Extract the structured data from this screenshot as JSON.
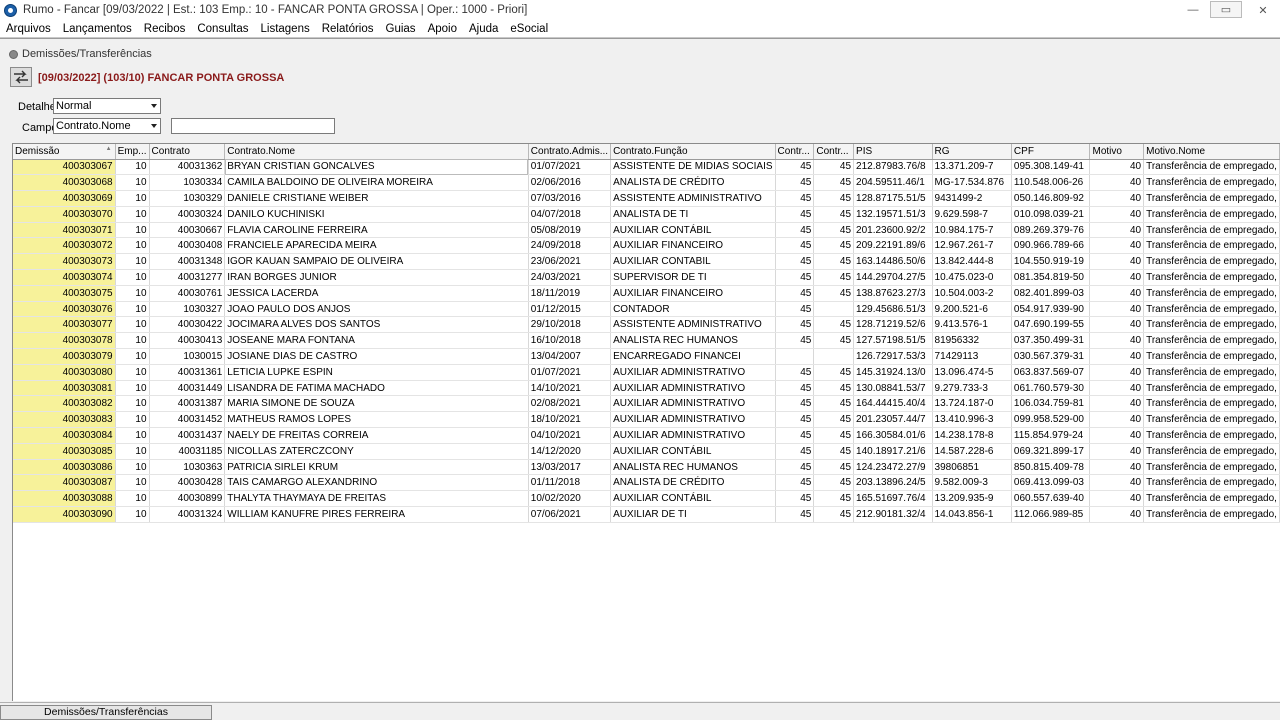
{
  "window": {
    "title": "Rumo - Fancar [09/03/2022 | Est.: 103 Emp.: 10 - FANCAR PONTA GROSSA | Oper.: 1000 - Priori]",
    "minimize": "—",
    "restore": "▭",
    "close": "✕"
  },
  "menu": [
    "Arquivos",
    "Lançamentos",
    "Recibos",
    "Consultas",
    "Listagens",
    "Relatórios",
    "Guias",
    "Apoio",
    "Ajuda",
    "eSocial"
  ],
  "document": {
    "title": "Demissões/Transferências",
    "info": "[09/03/2022] (103/10) FANCAR PONTA GROSSA"
  },
  "filters": {
    "detalhe_label": "Detalhe",
    "detalhe_value": "Normal",
    "campo_label": "Campo",
    "campo_value": "Contrato.Nome",
    "search_value": ""
  },
  "grid": {
    "columns": [
      "Demissão",
      "Emp...",
      "Contrato",
      "Contrato.Nome",
      "Contrato.Admis...",
      "Contrato.Função",
      "Contr...",
      "Contr...",
      "PIS",
      "RG",
      "CPF",
      "Motivo",
      "Motivo.Nome"
    ],
    "rows": [
      [
        "400303067",
        "10",
        "40031362",
        "BRYAN CRISTIAN GONCALVES",
        "01/07/2021",
        "ASSISTENTE DE MIDIAS SOCIAIS",
        "45",
        "45",
        "212.87983.76/8",
        "13.371.209-7",
        "095.308.149-41",
        "40",
        "Transferência de empregado,"
      ],
      [
        "400303068",
        "10",
        "1030334",
        "CAMILA BALDOINO DE OLIVEIRA MOREIRA",
        "02/06/2016",
        "ANALISTA DE CRÉDITO",
        "45",
        "45",
        "204.59511.46/1",
        "MG-17.534.876",
        "110.548.006-26",
        "40",
        "Transferência de empregado,"
      ],
      [
        "400303069",
        "10",
        "1030329",
        "DANIELE CRISTIANE WEIBER",
        "07/03/2016",
        "ASSISTENTE ADMINISTRATIVO",
        "45",
        "45",
        "128.87175.51/5",
        "9431499-2",
        "050.146.809-92",
        "40",
        "Transferência de empregado,"
      ],
      [
        "400303070",
        "10",
        "40030324",
        "DANILO KUCHINISKI",
        "04/07/2018",
        "ANALISTA DE TI",
        "45",
        "45",
        "132.19571.51/3",
        "9.629.598-7",
        "010.098.039-21",
        "40",
        "Transferência de empregado,"
      ],
      [
        "400303071",
        "10",
        "40030667",
        "FLAVIA CAROLINE FERREIRA",
        "05/08/2019",
        "AUXILIAR CONTÁBIL",
        "45",
        "45",
        "201.23600.92/2",
        "10.984.175-7",
        "089.269.379-76",
        "40",
        "Transferência de empregado,"
      ],
      [
        "400303072",
        "10",
        "40030408",
        "FRANCIELE APARECIDA MEIRA",
        "24/09/2018",
        "AUXILIAR FINANCEIRO",
        "45",
        "45",
        "209.22191.89/6",
        "12.967.261-7",
        "090.966.789-66",
        "40",
        "Transferência de empregado,"
      ],
      [
        "400303073",
        "10",
        "40031348",
        "IGOR KAUAN SAMPAIO DE OLIVEIRA",
        "23/06/2021",
        "AUXILIAR CONTABIL",
        "45",
        "45",
        "163.14486.50/6",
        "13.842.444-8",
        "104.550.919-19",
        "40",
        "Transferência de empregado,"
      ],
      [
        "400303074",
        "10",
        "40031277",
        "IRAN BORGES JUNIOR",
        "24/03/2021",
        "SUPERVISOR DE TI",
        "45",
        "45",
        "144.29704.27/5",
        "10.475.023-0",
        "081.354.819-50",
        "40",
        "Transferência de empregado,"
      ],
      [
        "400303075",
        "10",
        "40030761",
        "JESSICA LACERDA",
        "18/11/2019",
        "AUXILIAR FINANCEIRO",
        "45",
        "45",
        "138.87623.27/3",
        "10.504.003-2",
        "082.401.899-03",
        "40",
        "Transferência de empregado,"
      ],
      [
        "400303076",
        "10",
        "1030327",
        "JOAO PAULO DOS ANJOS",
        "01/12/2015",
        "CONTADOR",
        "45",
        "",
        "129.45686.51/3",
        "9.200.521-6",
        "054.917.939-90",
        "40",
        "Transferência de empregado,"
      ],
      [
        "400303077",
        "10",
        "40030422",
        "JOCIMARA ALVES DOS SANTOS",
        "29/10/2018",
        "ASSISTENTE ADMINISTRATIVO",
        "45",
        "45",
        "128.71219.52/6",
        "9.413.576-1",
        "047.690.199-55",
        "40",
        "Transferência de empregado,"
      ],
      [
        "400303078",
        "10",
        "40030413",
        "JOSEANE MARA FONTANA",
        "16/10/2018",
        "ANALISTA REC HUMANOS",
        "45",
        "45",
        "127.57198.51/5",
        "81956332",
        "037.350.499-31",
        "40",
        "Transferência de empregado,"
      ],
      [
        "400303079",
        "10",
        "1030015",
        "JOSIANE DIAS DE CASTRO",
        "13/04/2007",
        "ENCARREGADO FINANCEI",
        "",
        "",
        "126.72917.53/3",
        "71429113",
        "030.567.379-31",
        "40",
        "Transferência de empregado,"
      ],
      [
        "400303080",
        "10",
        "40031361",
        "LETICIA LUPKE ESPIN",
        "01/07/2021",
        "AUXILIAR ADMINISTRATIVO",
        "45",
        "45",
        "145.31924.13/0",
        "13.096.474-5",
        "063.837.569-07",
        "40",
        "Transferência de empregado,"
      ],
      [
        "400303081",
        "10",
        "40031449",
        "LISANDRA DE FATIMA MACHADO",
        "14/10/2021",
        "AUXILIAR ADMINISTRATIVO",
        "45",
        "45",
        "130.08841.53/7",
        "9.279.733-3",
        "061.760.579-30",
        "40",
        "Transferência de empregado,"
      ],
      [
        "400303082",
        "10",
        "40031387",
        "MARIA SIMONE DE SOUZA",
        "02/08/2021",
        "AUXILIAR ADMINISTRATIVO",
        "45",
        "45",
        "164.44415.40/4",
        "13.724.187-0",
        "106.034.759-81",
        "40",
        "Transferência de empregado,"
      ],
      [
        "400303083",
        "10",
        "40031452",
        "MATHEUS RAMOS LOPES",
        "18/10/2021",
        "AUXILIAR ADMINISTRATIVO",
        "45",
        "45",
        "201.23057.44/7",
        "13.410.996-3",
        "099.958.529-00",
        "40",
        "Transferência de empregado,"
      ],
      [
        "400303084",
        "10",
        "40031437",
        "NAELY DE FREITAS CORREIA",
        "04/10/2021",
        "AUXILIAR ADMINISTRATIVO",
        "45",
        "45",
        "166.30584.01/6",
        "14.238.178-8",
        "115.854.979-24",
        "40",
        "Transferência de empregado,"
      ],
      [
        "400303085",
        "10",
        "40031185",
        "NICOLLAS ZATERCZCONY",
        "14/12/2020",
        "AUXILIAR CONTÁBIL",
        "45",
        "45",
        "140.18917.21/6",
        "14.587.228-6",
        "069.321.899-17",
        "40",
        "Transferência de empregado,"
      ],
      [
        "400303086",
        "10",
        "1030363",
        "PATRICIA SIRLEI KRUM",
        "13/03/2017",
        "ANALISTA REC HUMANOS",
        "45",
        "45",
        "124.23472.27/9",
        "39806851",
        "850.815.409-78",
        "40",
        "Transferência de empregado,"
      ],
      [
        "400303087",
        "10",
        "40030428",
        "TAIS CAMARGO ALEXANDRINO",
        "01/11/2018",
        "ANALISTA DE CRÉDITO",
        "45",
        "45",
        "203.13896.24/5",
        "9.582.009-3",
        "069.413.099-03",
        "40",
        "Transferência de empregado,"
      ],
      [
        "400303088",
        "10",
        "40030899",
        "THALYTA THAYMAYA DE FREITAS",
        "10/02/2020",
        "AUXILIAR CONTÁBIL",
        "45",
        "45",
        "165.51697.76/4",
        "13.209.935-9",
        "060.557.639-40",
        "40",
        "Transferência de empregado,"
      ],
      [
        "400303090",
        "10",
        "40031324",
        "WILLIAM KANUFRE PIRES FERREIRA",
        "07/06/2021",
        "AUXILIAR DE TI",
        "45",
        "45",
        "212.90181.32/4",
        "14.043.856-1",
        "112.066.989-85",
        "40",
        "Transferência de empregado,"
      ]
    ]
  },
  "footer": {
    "tab_label": "Demissões/Transferências"
  },
  "colors": {
    "highlight": "#f7f29a",
    "info_text": "#8a1a1a"
  }
}
